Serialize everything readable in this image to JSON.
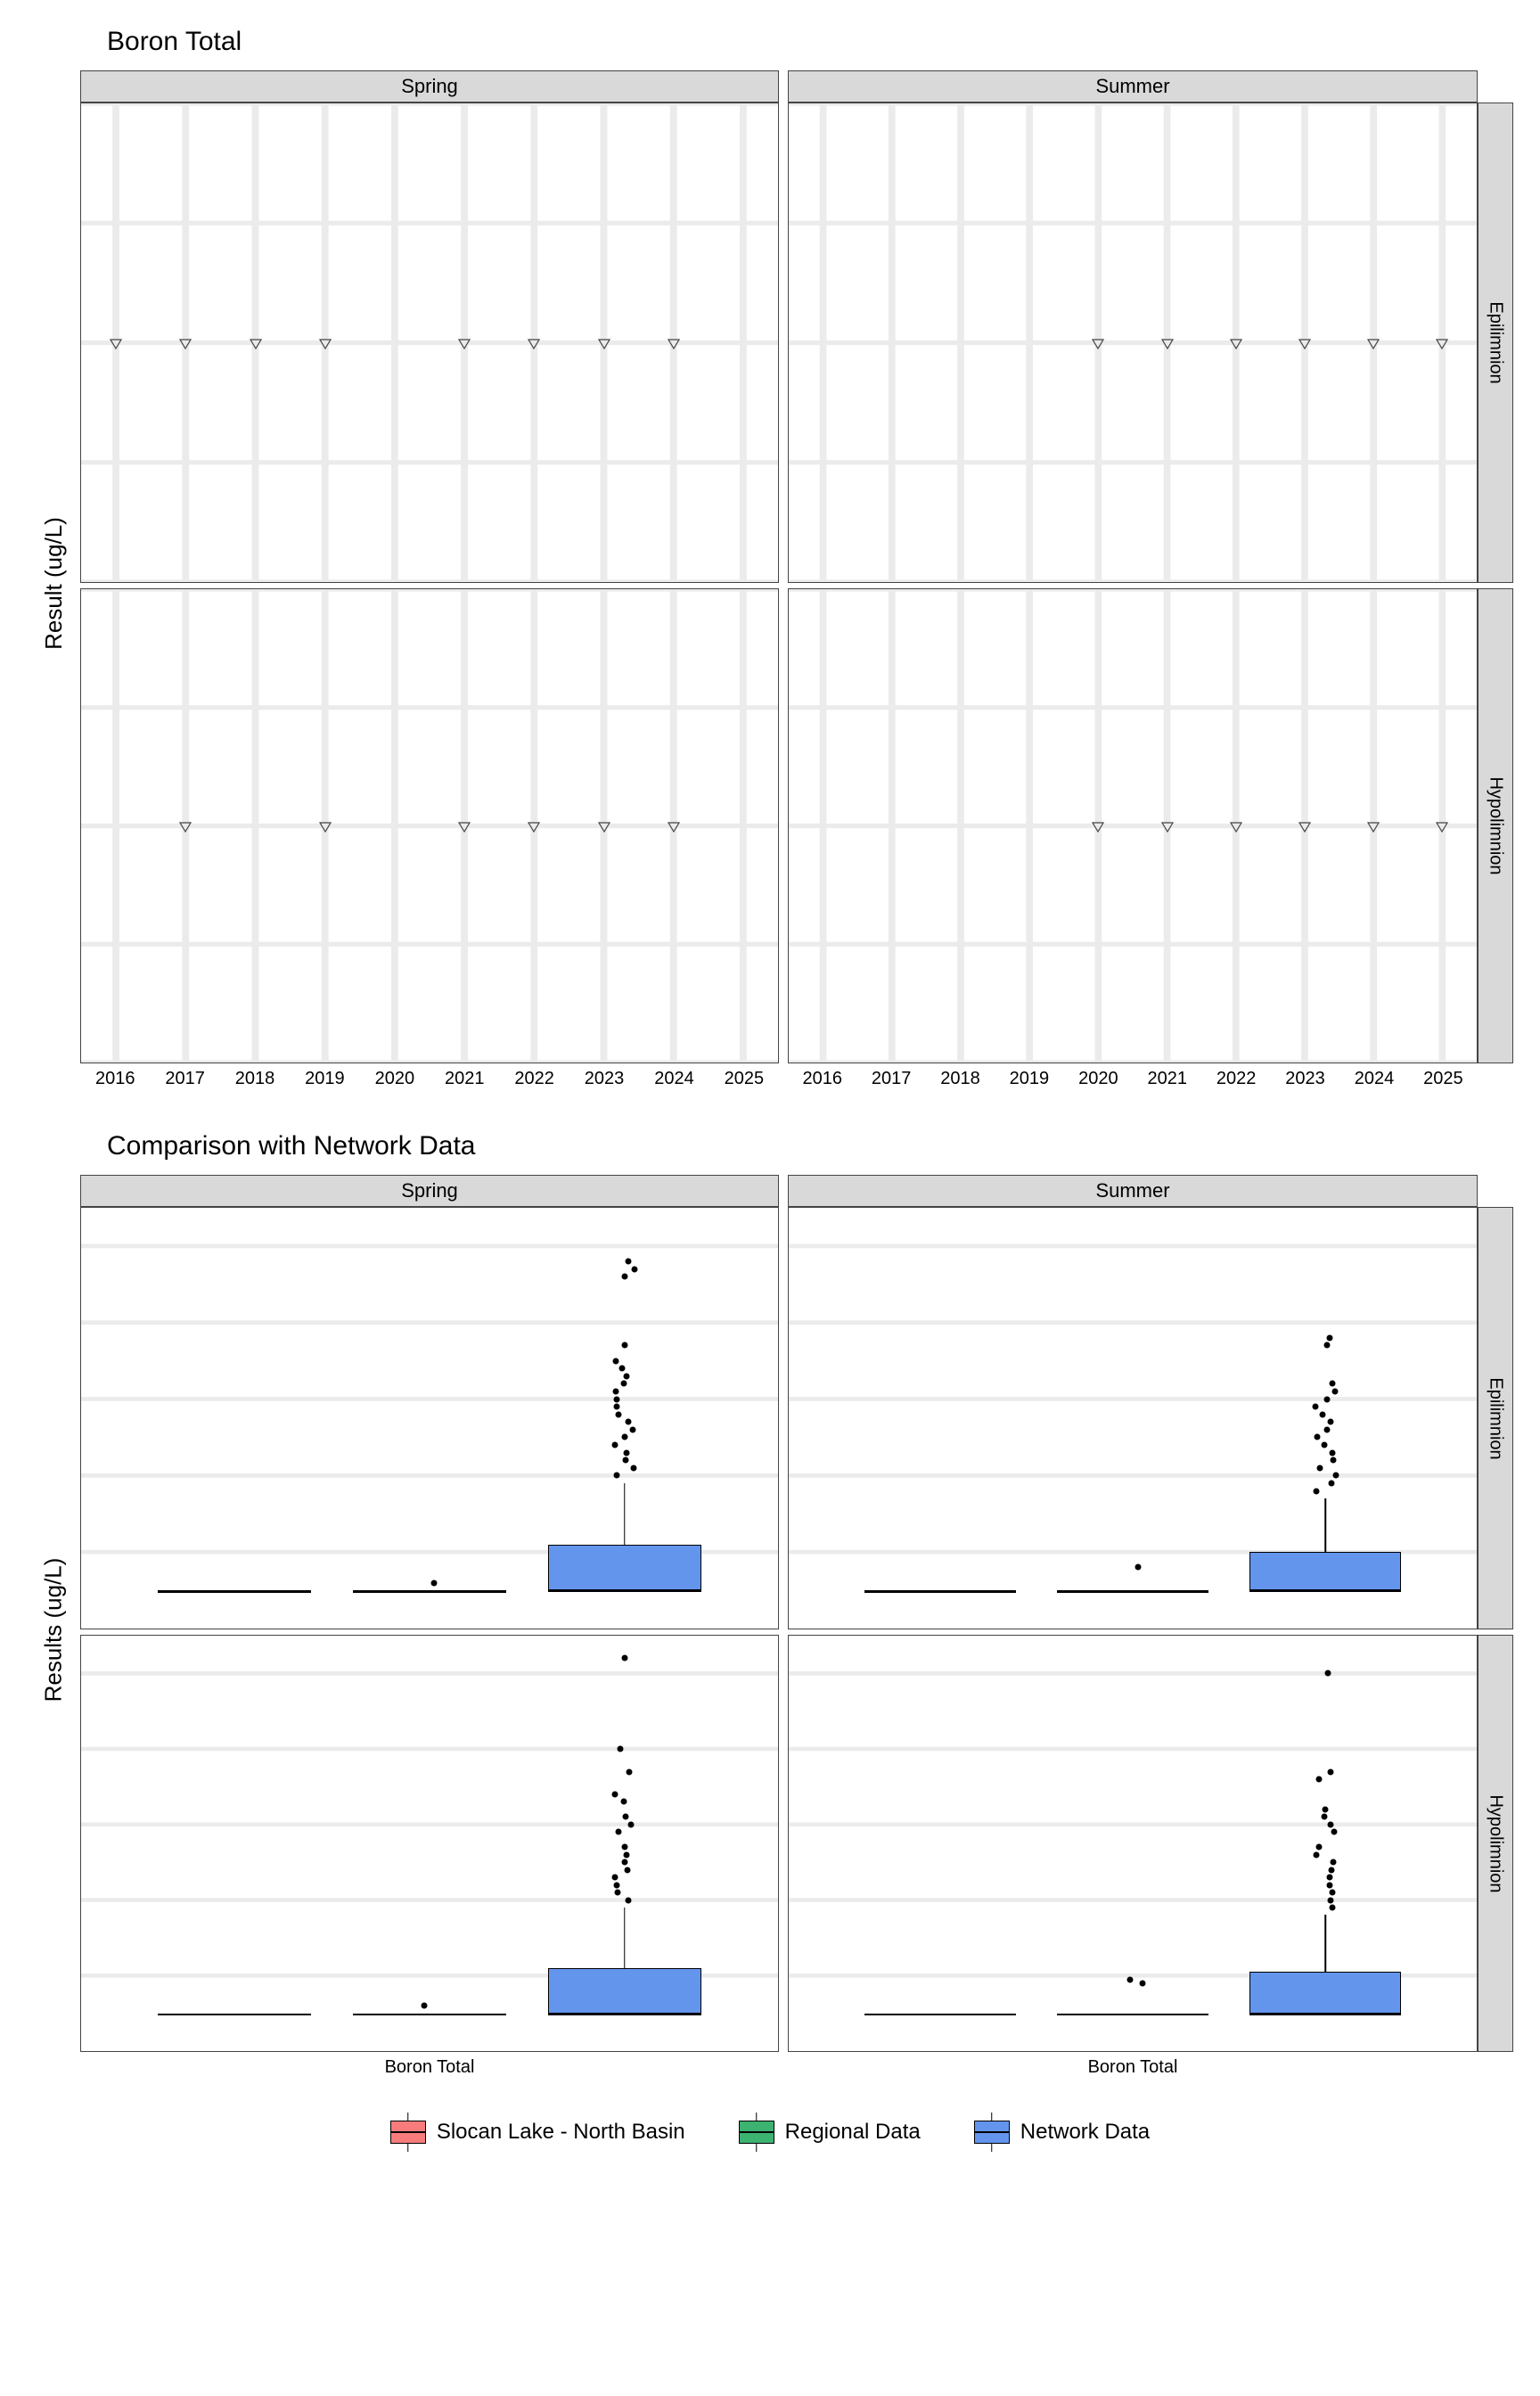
{
  "titles": {
    "top": "Boron Total",
    "bottom": "Comparison with Network Data"
  },
  "axes": {
    "top_y": "Result (ug/L)",
    "bottom_y": "Results (ug/L)"
  },
  "facets": {
    "cols": [
      "Spring",
      "Summer"
    ],
    "rows": [
      "Epilimnion",
      "Hypolimnion"
    ]
  },
  "legend": [
    {
      "label": "Slocan Lake - North Basin",
      "color": "red"
    },
    {
      "label": "Regional Data",
      "color": "green"
    },
    {
      "label": "Network Data",
      "color": "blue"
    }
  ],
  "top_y_ticks": [
    "4.950",
    "4.975",
    "5.000",
    "5.025",
    "5.050"
  ],
  "top_x_ticks": [
    "2016",
    "2017",
    "2018",
    "2019",
    "2020",
    "2021",
    "2022",
    "2023",
    "2024",
    "2025"
  ],
  "bottom_y_ticks": [
    "10",
    "20",
    "30",
    "40",
    "50"
  ],
  "bottom_x_label": "Boron Total",
  "chart_data": {
    "top": {
      "type": "scatter",
      "ylim": [
        4.95,
        5.05
      ],
      "xlabel": "",
      "ylabel": "Result (ug/L)",
      "facets": [
        {
          "col": "Spring",
          "row": "Epilimnion",
          "points": [
            [
              2016,
              5.0
            ],
            [
              2017,
              5.0
            ],
            [
              2018,
              5.0
            ],
            [
              2019,
              5.0
            ],
            [
              2021,
              5.0
            ],
            [
              2022,
              5.0
            ],
            [
              2023,
              5.0
            ],
            [
              2024,
              5.0
            ]
          ]
        },
        {
          "col": "Summer",
          "row": "Epilimnion",
          "points": [
            [
              2020,
              5.0
            ],
            [
              2021,
              5.0
            ],
            [
              2022,
              5.0
            ],
            [
              2023,
              5.0
            ],
            [
              2024,
              5.0
            ],
            [
              2025,
              5.0
            ]
          ]
        },
        {
          "col": "Spring",
          "row": "Hypolimnion",
          "points": [
            [
              2017,
              5.0
            ],
            [
              2019,
              5.0
            ],
            [
              2021,
              5.0
            ],
            [
              2022,
              5.0
            ],
            [
              2023,
              5.0
            ],
            [
              2024,
              5.0
            ]
          ]
        },
        {
          "col": "Summer",
          "row": "Hypolimnion",
          "points": [
            [
              2020,
              5.0
            ],
            [
              2021,
              5.0
            ],
            [
              2022,
              5.0
            ],
            [
              2023,
              5.0
            ],
            [
              2024,
              5.0
            ],
            [
              2025,
              5.0
            ]
          ]
        }
      ]
    },
    "bottom": {
      "type": "box",
      "ylim": [
        0,
        55
      ],
      "xlabel": "",
      "ylabel": "Results (ug/L)",
      "categories": [
        "Boron Total"
      ],
      "facets": [
        {
          "col": "Spring",
          "row": "Epilimnion",
          "boxes": [
            {
              "series": "Slocan Lake - North Basin",
              "min": 5,
              "q1": 5,
              "median": 5,
              "q3": 5,
              "max": 5,
              "outliers": []
            },
            {
              "series": "Regional Data",
              "min": 5,
              "q1": 5,
              "median": 5,
              "q3": 5,
              "max": 5,
              "outliers": [
                6
              ]
            },
            {
              "series": "Network Data",
              "min": 5,
              "q1": 5,
              "median": 5,
              "q3": 11,
              "max": 19,
              "outliers": [
                20,
                21,
                22,
                23,
                24,
                25,
                26,
                27,
                28,
                29,
                30,
                31,
                32,
                33,
                34,
                35,
                37,
                46,
                47,
                48
              ]
            }
          ]
        },
        {
          "col": "Summer",
          "row": "Epilimnion",
          "boxes": [
            {
              "series": "Slocan Lake - North Basin",
              "min": 5,
              "q1": 5,
              "median": 5,
              "q3": 5,
              "max": 5,
              "outliers": []
            },
            {
              "series": "Regional Data",
              "min": 5,
              "q1": 5,
              "median": 5,
              "q3": 5,
              "max": 5,
              "outliers": [
                8
              ]
            },
            {
              "series": "Network Data",
              "min": 5,
              "q1": 5,
              "median": 5,
              "q3": 10,
              "max": 17,
              "outliers": [
                18,
                19,
                20,
                21,
                22,
                23,
                24,
                25,
                26,
                27,
                28,
                29,
                30,
                31,
                32,
                37,
                38
              ]
            }
          ]
        },
        {
          "col": "Spring",
          "row": "Hypolimnion",
          "boxes": [
            {
              "series": "Slocan Lake - North Basin",
              "min": 5,
              "q1": 5,
              "median": 5,
              "q3": 5,
              "max": 5,
              "outliers": []
            },
            {
              "series": "Regional Data",
              "min": 5,
              "q1": 5,
              "median": 5,
              "q3": 5,
              "max": 5,
              "outliers": [
                6
              ]
            },
            {
              "series": "Network Data",
              "min": 5,
              "q1": 5,
              "median": 5,
              "q3": 11,
              "max": 19,
              "outliers": [
                20,
                21,
                22,
                23,
                24,
                25,
                26,
                27,
                29,
                30,
                31,
                33,
                34,
                37,
                40,
                52
              ]
            }
          ]
        },
        {
          "col": "Summer",
          "row": "Hypolimnion",
          "boxes": [
            {
              "series": "Slocan Lake - North Basin",
              "min": 5,
              "q1": 5,
              "median": 5,
              "q3": 5,
              "max": 5,
              "outliers": []
            },
            {
              "series": "Regional Data",
              "min": 5,
              "q1": 5,
              "median": 5,
              "q3": 5,
              "max": 5,
              "outliers": [
                9,
                9.5
              ]
            },
            {
              "series": "Network Data",
              "min": 5,
              "q1": 5,
              "median": 5,
              "q3": 10.5,
              "max": 18,
              "outliers": [
                19,
                20,
                21,
                22,
                23,
                24,
                25,
                26,
                27,
                29,
                30,
                31,
                32,
                36,
                37,
                50
              ]
            }
          ]
        }
      ]
    }
  }
}
